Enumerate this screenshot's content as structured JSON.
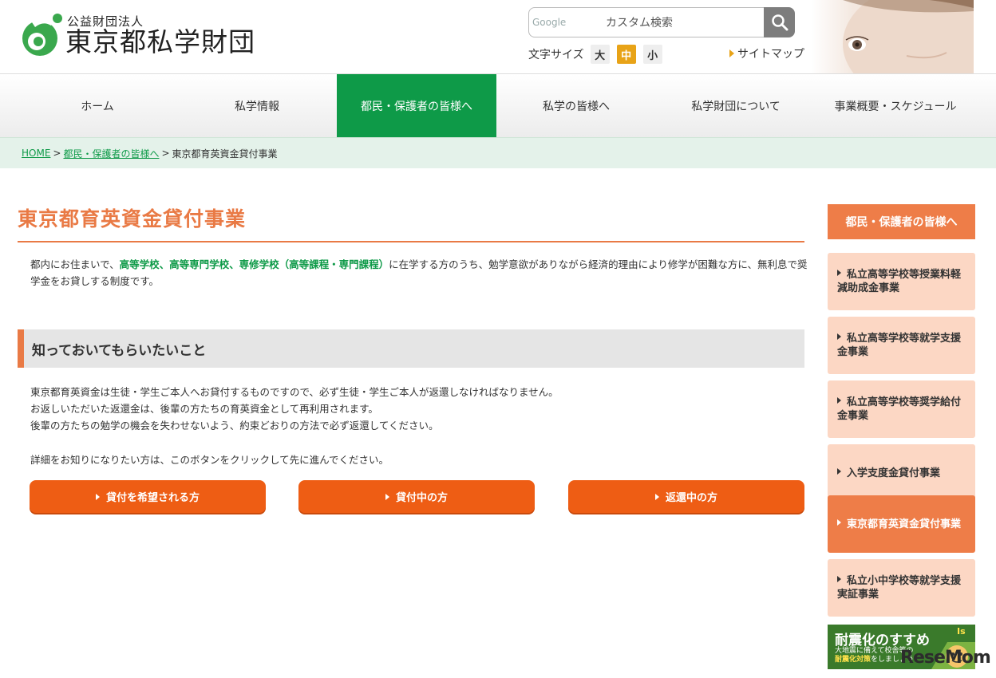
{
  "header": {
    "logo_sub": "公益財団法人",
    "logo_main": "東京都私学財団",
    "search": {
      "brand": "Google",
      "placeholder": "カスタム検索"
    },
    "font_size": {
      "label": "文字サイズ",
      "large": "大",
      "medium": "中",
      "small": "小",
      "selected": "中"
    },
    "sitemap": "サイトマップ"
  },
  "nav": {
    "items": [
      {
        "label": "ホーム"
      },
      {
        "label": "私学情報"
      },
      {
        "label": "都民・保護者の皆様へ",
        "active": true
      },
      {
        "label": "私学の皆様へ"
      },
      {
        "label": "私学財団について"
      },
      {
        "label": "事業概要・スケジュール"
      }
    ]
  },
  "breadcrumb": {
    "home": "HOME",
    "parent": "都民・保護者の皆様へ",
    "current": "東京都育英資金貸付事業",
    "sep": ">"
  },
  "main": {
    "title": "東京都育英資金貸付事業",
    "intro_pre": "都内にお住まいで、",
    "intro_highlight": "高等学校、高等専門学校、専修学校（高等課程・専門課程）",
    "intro_post": "に在学する方のうち、勉学意欲がありながら経済的理由により修学が困難な方に、無利息で奨学金をお貸しする制度です。",
    "subheading": "知っておいてもらいたいこと",
    "body_lines": [
      "東京都育英資金は生徒・学生ご本人へお貸付するものですので、必ず生徒・学生ご本人が返還しなければなりません。",
      "お返しいただいた返還金は、後輩の方たちの育英資金として再利用されます。",
      "後輩の方たちの勉学の機会を失わせないよう、約束どおりの方法で必ず返還してください。"
    ],
    "detail": "詳細をお知りになりたい方は、このボタンをクリックして先に進んでください。",
    "buttons": [
      {
        "label": "貸付を希望される方"
      },
      {
        "label": "貸付中の方"
      },
      {
        "label": "返還中の方"
      }
    ]
  },
  "sidebar": {
    "heading": "都民・保護者の皆様へ",
    "items": [
      {
        "label": "私立高等学校等授業料軽減助成金事業"
      },
      {
        "label": "私立高等学校等就学支援金事業"
      },
      {
        "label": "私立高等学校等奨学給付金事業"
      },
      {
        "label": "入学支度金貸付事業"
      },
      {
        "label": "東京都育英資金貸付事業",
        "active": true
      },
      {
        "label": "私立小中学校等就学支援実証事業"
      }
    ],
    "banner": {
      "title": "耐震化のすすめ",
      "sub1": "大地震に備えて校舎等の",
      "sub2_highlight": "耐震化対策",
      "sub2_rest": "をしましょう",
      "badge": "Is"
    }
  },
  "watermark": "ReseMom",
  "colors": {
    "brand_green": "#0e9a48",
    "accent_orange": "#e97a45",
    "button_orange": "#ee5d14",
    "sidebar_light": "#fcd7c4",
    "font_active": "#e8a317"
  }
}
